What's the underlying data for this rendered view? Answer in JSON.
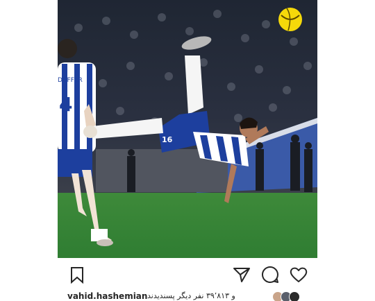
{
  "post": {
    "image_alt": "Footballer in blue and white striped kit performing an overhead bicycle kick toward the ball in a stadium",
    "player_shirt_number": "16",
    "defender_shirt_number": "4",
    "defender_shirt_name": "DUFFER"
  },
  "actions": {
    "save_icon": "bookmark-icon",
    "share_icon": "send-icon",
    "comment_icon": "comment-icon",
    "like_icon": "heart-icon"
  },
  "likes": {
    "username": "vahid.hashemian",
    "text": "و ۳۹٬۸۱۳ نفر دیگر پسندیدند"
  },
  "colors": {
    "text": "#262626",
    "pitch": "#2f7d32",
    "kit_blue": "#1d3f9e",
    "ball": "#f5d90a"
  }
}
